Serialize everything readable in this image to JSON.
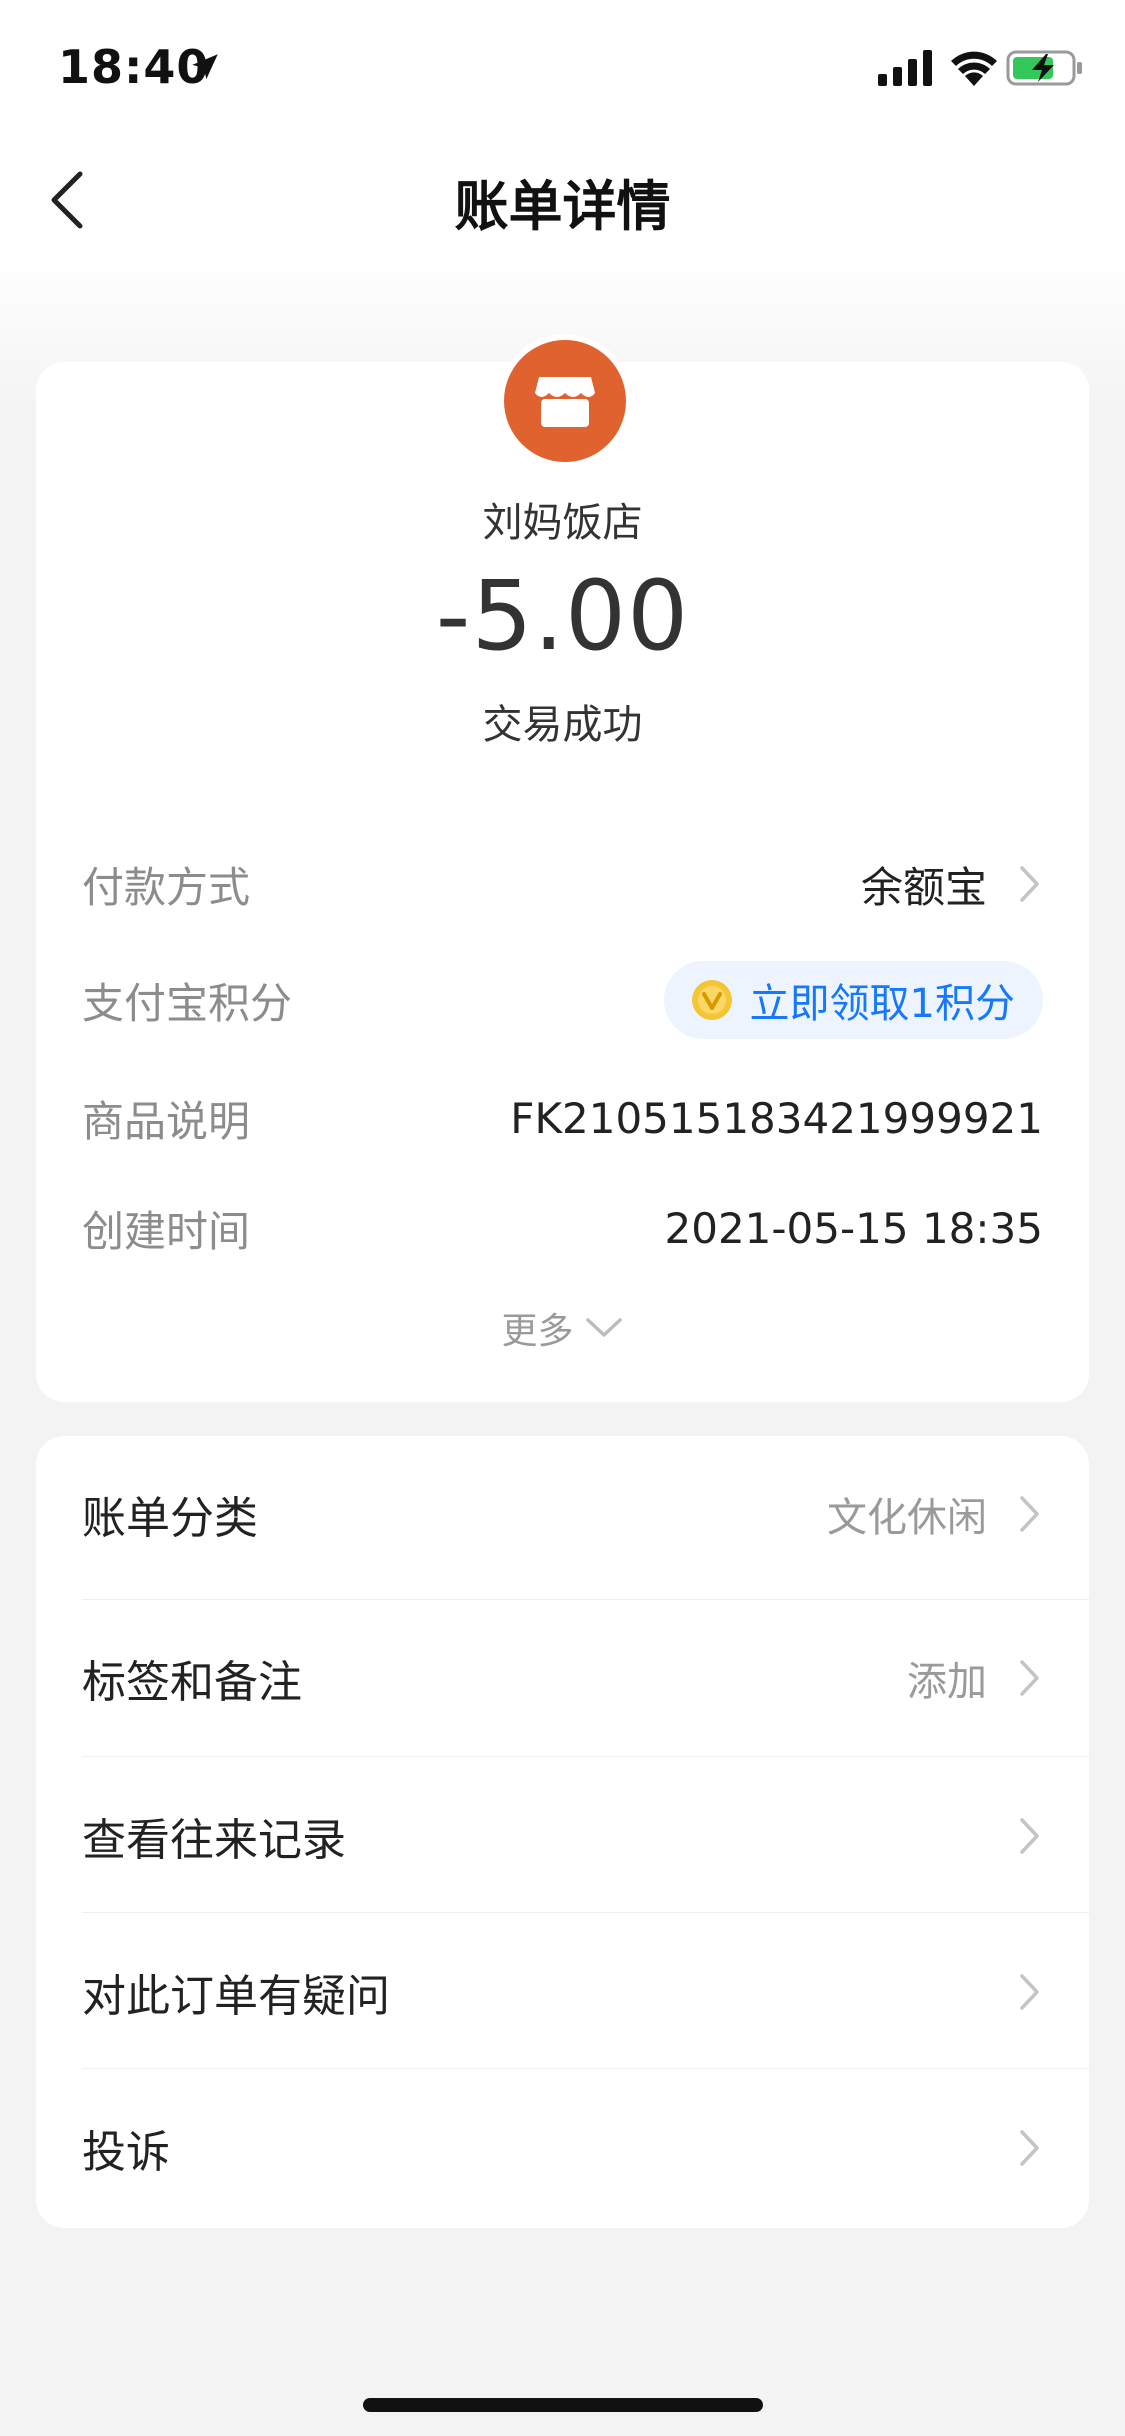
{
  "status_bar": {
    "time": "18:40"
  },
  "nav": {
    "title": "账单详情"
  },
  "bill": {
    "merchant": "刘妈饭店",
    "amount": "-5.00",
    "status": "交易成功",
    "merchant_icon_color": "#e0622f"
  },
  "details": [
    {
      "label": "付款方式",
      "value": "余额宝"
    },
    {
      "label": "支付宝积分",
      "value": "立即领取1积分"
    },
    {
      "label": "商品说明",
      "value": "FK2105151834219999​21"
    },
    {
      "label": "创建时间",
      "value": "2021-05-15 18:35"
    }
  ],
  "more_label": "更多",
  "actions": [
    {
      "label": "账单分类",
      "value": "文化休闲"
    },
    {
      "label": "标签和备注",
      "value": "添加"
    },
    {
      "label": "查看往来记录",
      "value": ""
    },
    {
      "label": "对此订单有疑问",
      "value": ""
    },
    {
      "label": "投诉",
      "value": ""
    }
  ],
  "colors": {
    "accent_blue": "#1677ff",
    "pill_bg": "#eef4fd",
    "page_bg": "#f3f3f3"
  }
}
